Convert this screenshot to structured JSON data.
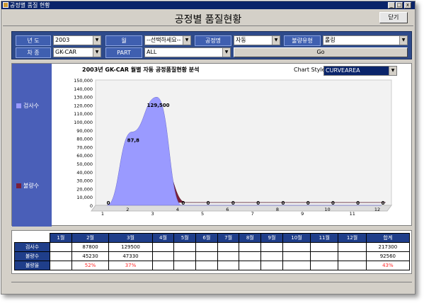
{
  "window": {
    "title": "공정별 품질 현황",
    "heading": "공정별 품질현황",
    "close_label": "닫기",
    "min": "_",
    "max": "□",
    "x": "x"
  },
  "filters": {
    "year_label": "년   도",
    "year_value": "2003",
    "month_label": "월",
    "month_value": "--선택하세요--",
    "process_label": "공정명",
    "process_value": "자동",
    "defect_label": "불량유형",
    "defect_value": "롤링",
    "car_label": "차   종",
    "car_value": "GK-CAR",
    "part_label": "PART",
    "part_value": "ALL",
    "go_label": "Go"
  },
  "legend": {
    "inspect": "검사수",
    "defect": "불량수",
    "inspect_color": "#9a9aff",
    "defect_color": "#7a1f3a"
  },
  "chart_style": {
    "label": "Chart Style :",
    "value": "CURVEAREA"
  },
  "chart_data": {
    "type": "area",
    "title": "2003년 GK-CAR 월별 자동 공정품질현황 분석",
    "x": [
      1,
      2,
      3,
      4,
      5,
      6,
      7,
      8,
      9,
      10,
      11,
      12
    ],
    "series": [
      {
        "name": "검사수",
        "values": [
          0,
          87800,
          129500,
          0,
          0,
          0,
          0,
          0,
          0,
          0,
          0,
          0
        ]
      },
      {
        "name": "불량수",
        "values": [
          0,
          45230,
          47330,
          0,
          0,
          0,
          0,
          0,
          0,
          0,
          0,
          0
        ]
      }
    ],
    "point_labels": [
      "0",
      "87,8",
      "129,500",
      "0",
      "0",
      "0",
      "0",
      "0",
      "0",
      "0",
      "0",
      "0"
    ],
    "yticks": [
      "0",
      "10,000",
      "20,000",
      "30,000",
      "40,000",
      "50,000",
      "60,000",
      "70,000",
      "80,000",
      "90,000",
      "100,000",
      "110,000",
      "120,000",
      "130,000",
      "140,000",
      "150,000"
    ],
    "xticks": [
      "1",
      "2",
      "3",
      "4",
      "5",
      "6",
      "7",
      "8",
      "9",
      "10",
      "11",
      "12"
    ],
    "ylim": [
      0,
      150000
    ]
  },
  "table": {
    "headers": [
      "",
      "1월",
      "2월",
      "3월",
      "4월",
      "5월",
      "6월",
      "7월",
      "8월",
      "9월",
      "10월",
      "11월",
      "12월",
      "합계"
    ],
    "rows": [
      {
        "label": "검사수",
        "cells": [
          "",
          "87800",
          "129500",
          "",
          "",
          "",
          "",
          "",
          "",
          "",
          "",
          "",
          "217300"
        ]
      },
      {
        "label": "불량수",
        "cells": [
          "",
          "45230",
          "47330",
          "",
          "",
          "",
          "",
          "",
          "",
          "",
          "",
          "",
          "92560"
        ]
      },
      {
        "label": "불량율",
        "cells": [
          "",
          "52%",
          "37%",
          "",
          "",
          "",
          "",
          "",
          "",
          "",
          "",
          "",
          "43%"
        ]
      }
    ]
  }
}
